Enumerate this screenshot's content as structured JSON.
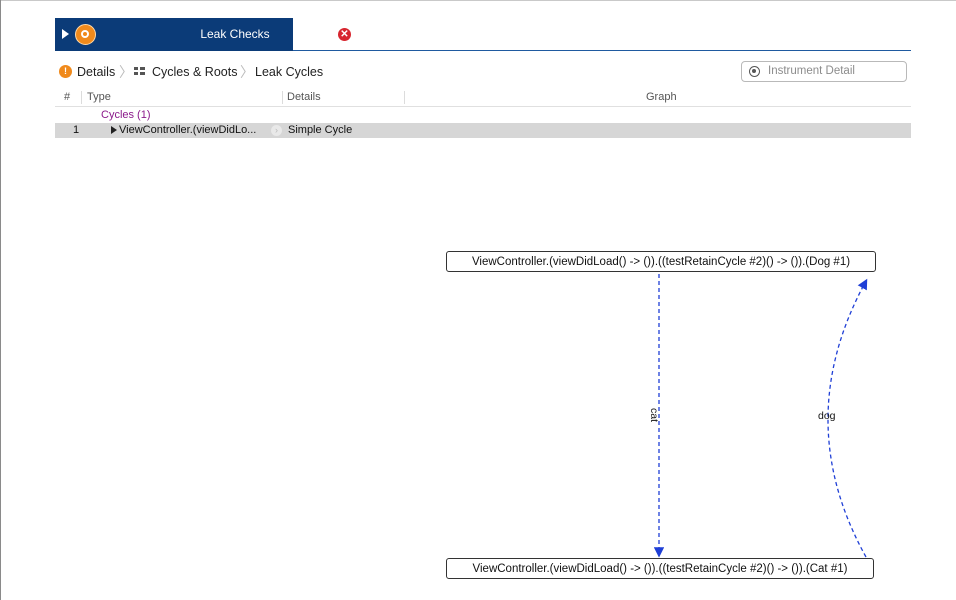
{
  "track": {
    "label": "Leak Checks",
    "error_icon_glyph": "✕"
  },
  "breadcrumb": {
    "items": [
      "Details",
      "Cycles & Roots",
      "Leak Cycles"
    ],
    "separator": "〉"
  },
  "search": {
    "placeholder": "Instrument Detail"
  },
  "table": {
    "columns": [
      "#",
      "Type",
      "Details",
      "Graph"
    ],
    "group_label": "Cycles (1)",
    "rows": [
      {
        "index": "1",
        "type": "ViewController.(viewDidLo...",
        "details": "Simple Cycle"
      }
    ]
  },
  "graph": {
    "nodes": [
      "ViewController.(viewDidLoad() -> ()).((testRetainCycle #2)() -> ()).(Dog #1)",
      "ViewController.(viewDidLoad() -> ()).((testRetainCycle #2)() -> ()).(Cat #1)"
    ],
    "edges": [
      {
        "label": "cat",
        "from": 0,
        "to": 1
      },
      {
        "label": "dog",
        "from": 1,
        "to": 0
      }
    ],
    "edge_color": "#1f3fd6"
  },
  "icons": {
    "track_play": "play-triangle-icon",
    "track_badge": "instrument-badge-icon",
    "error": "error-x-icon",
    "details": "details-orange-icon",
    "cycles_roots": "grid-icon",
    "search": "search-icon",
    "row_disclosure": "disclosure-triangle-icon",
    "focus": "focus-arrow-icon"
  }
}
